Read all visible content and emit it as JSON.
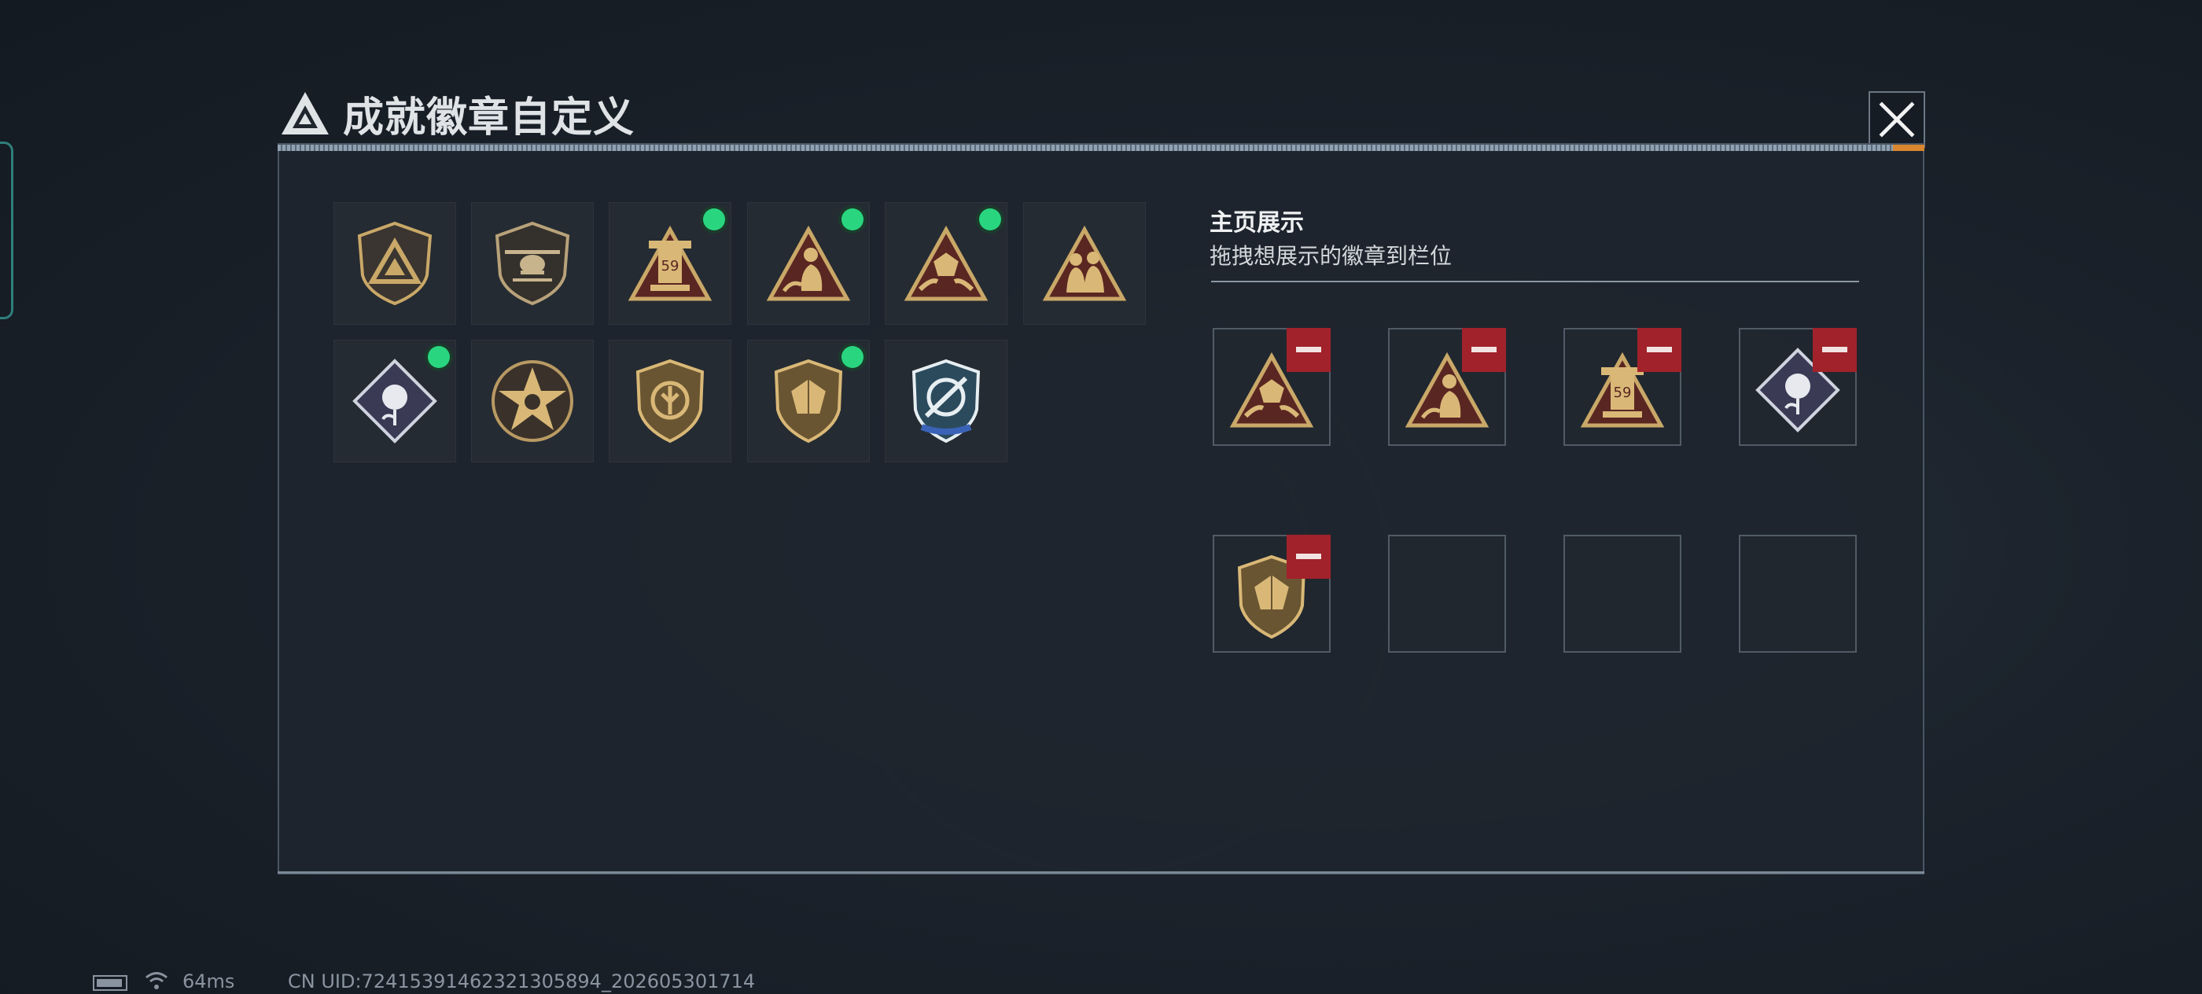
{
  "dialog": {
    "title": "成就徽章自定义",
    "close_icon": "close-icon"
  },
  "badges": [
    {
      "name": "triangle-shield-badge",
      "new": false
    },
    {
      "name": "helicopter-shield-badge",
      "new": false
    },
    {
      "name": "tower-59-triangle-badge",
      "new": true
    },
    {
      "name": "figure-triangle-badge",
      "new": true
    },
    {
      "name": "dice-hands-triangle-badge",
      "new": true
    },
    {
      "name": "soldiers-triangle-badge",
      "new": false
    },
    {
      "name": "rose-diamond-badge",
      "new": true
    },
    {
      "name": "star-skull-circle-badge",
      "new": false
    },
    {
      "name": "emblem-shield-badge",
      "new": false
    },
    {
      "name": "dice-shield-badge",
      "new": true
    },
    {
      "name": "crossed-knife-blue-shield-badge",
      "new": false
    }
  ],
  "showcase": {
    "title": "主页展示",
    "subtitle": "拖拽想展示的徽章到栏位",
    "slots": [
      {
        "badge": "dice-hands-triangle-badge"
      },
      {
        "badge": "figure-triangle-badge"
      },
      {
        "badge": "tower-59-triangle-badge"
      },
      {
        "badge": "rose-diamond-badge"
      },
      {
        "badge": "dice-shield-badge"
      },
      {
        "badge": null
      },
      {
        "badge": null
      },
      {
        "badge": null
      }
    ],
    "remove_icon": "minus-icon"
  },
  "status_bar": {
    "ping": "64ms",
    "uid": "CN UID:7241539146232130589​4_202605301714"
  },
  "colors": {
    "new_dot": "#29d67f",
    "remove": "#a1222a",
    "gold": "#c9a868"
  }
}
